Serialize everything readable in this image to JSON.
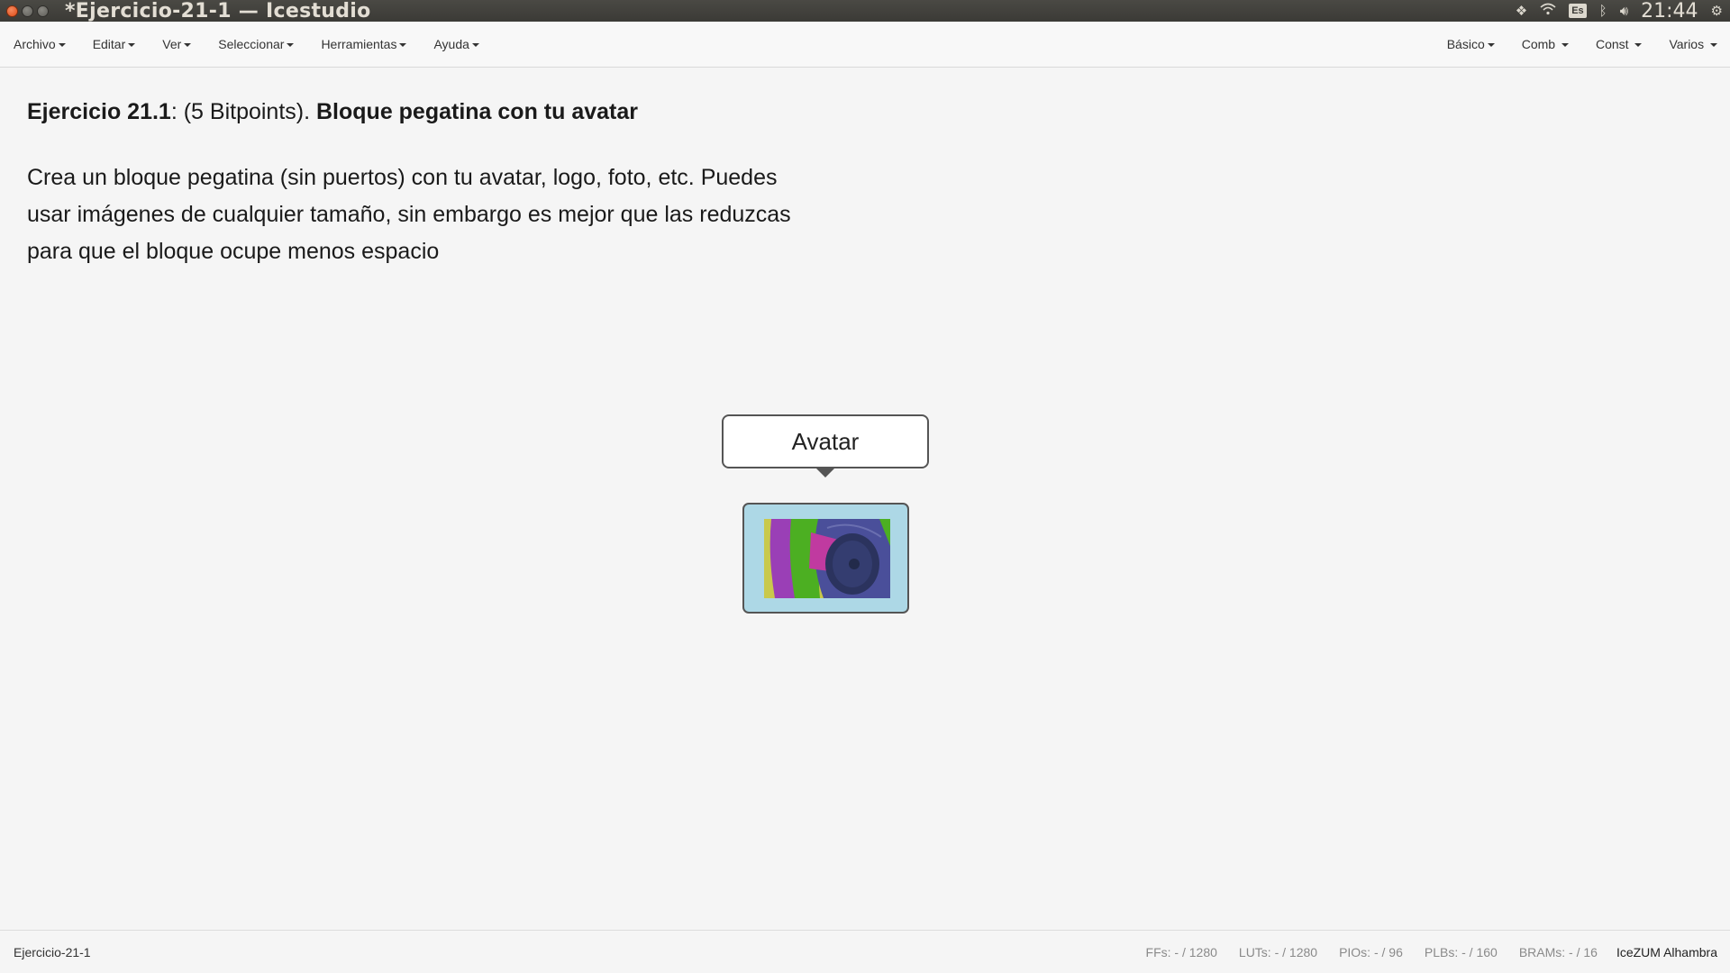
{
  "titlebar": {
    "title": "*Ejercicio-21-1 — Icestudio",
    "keyboard_layout": "Es",
    "clock": "21:44"
  },
  "menu": {
    "left": [
      "Archivo",
      "Editar",
      "Ver",
      "Seleccionar",
      "Herramientas",
      "Ayuda"
    ],
    "right": [
      "Básico",
      "Comb",
      "Const",
      "Varios"
    ]
  },
  "content": {
    "heading_bold1": "Ejercicio 21.1",
    "heading_mid": ": (5 Bitpoints). ",
    "heading_bold2": "Bloque pegatina con tu avatar",
    "description_lines": [
      "Crea un bloque pegatina (sin puertos) con tu avatar, logo, foto, etc. Puedes",
      "usar imágenes de cualquier tamaño, sin embargo es mejor que las reduzcas",
      "para que el bloque ocupe menos espacio"
    ]
  },
  "block": {
    "tooltip_label": "Avatar",
    "background_color": "#add8e6"
  },
  "statusbar": {
    "filename": "Ejercicio-21-1",
    "ffs": "FFs:  - / 1280",
    "luts": "LUTs:  - / 1280",
    "pios": "PIOs:  - / 96",
    "plbs": "PLBs:  - / 160",
    "brams": "BRAMs:  - / 16",
    "board": "IceZUM Alhambra"
  },
  "colors": {
    "titlebar": "#3b3a36",
    "close_button": "#df4b16",
    "canvas": "#f5f5f5"
  }
}
